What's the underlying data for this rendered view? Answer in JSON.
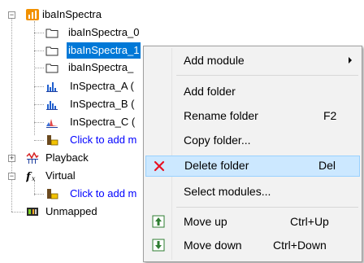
{
  "tree": {
    "root_label": "ibaInSpectra",
    "children": [
      "ibaInSpectra_0",
      "ibaInSpectra_1",
      "ibaInSpectra_",
      "InSpectra_A (",
      "InSpectra_B (",
      "InSpectra_C (",
      "Click to add m"
    ],
    "playback": "Playback",
    "virtual": "Virtual",
    "virtual_child": "Click to add m",
    "unmapped": "Unmapped"
  },
  "menu": {
    "items": [
      {
        "label": "Add module",
        "shortcut": ""
      },
      {
        "label": "Add folder",
        "shortcut": ""
      },
      {
        "label": "Rename folder",
        "shortcut": "F2"
      },
      {
        "label": "Copy folder...",
        "shortcut": ""
      },
      {
        "label": "Delete folder",
        "shortcut": "Del"
      },
      {
        "label": "Select modules...",
        "shortcut": ""
      },
      {
        "label": "Move up",
        "shortcut": "Ctrl+Up"
      },
      {
        "label": "Move down",
        "shortcut": "Ctrl+Down"
      }
    ]
  },
  "colors": {
    "selection": "#0078d7",
    "hover": "#cce8ff",
    "delete_x": "#e81123",
    "link": "#0000ff",
    "menu_bg": "#f2f2f2"
  }
}
